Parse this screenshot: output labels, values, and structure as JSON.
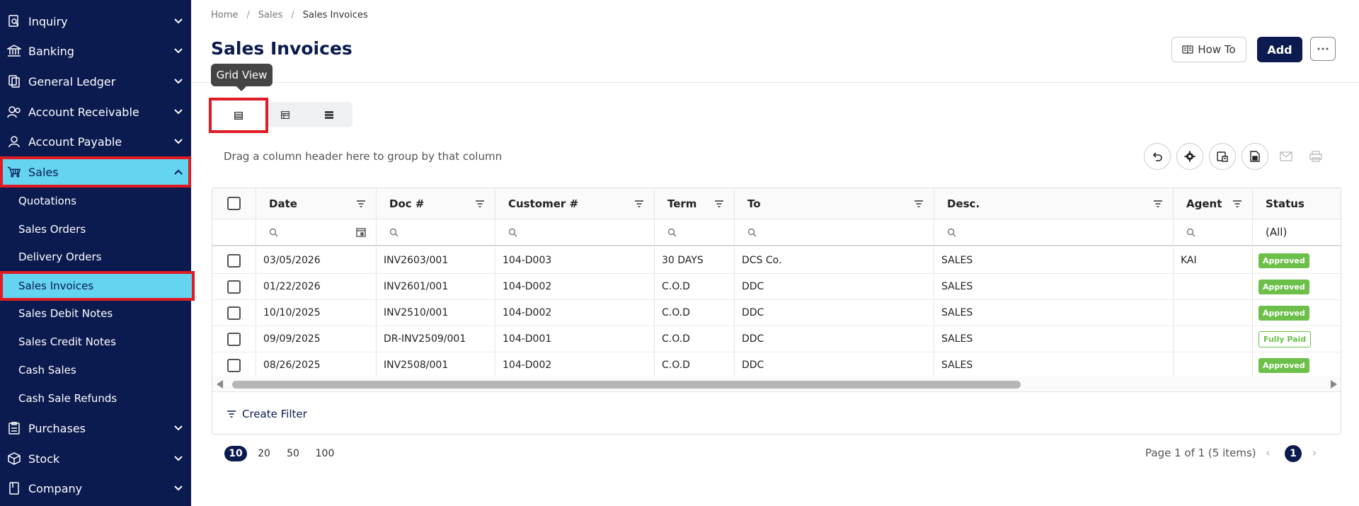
{
  "sidebar": {
    "items": [
      {
        "label": "Inquiry",
        "icon": "inquiry-icon"
      },
      {
        "label": "Banking",
        "icon": "bank-icon"
      },
      {
        "label": "General Ledger",
        "icon": "ledger-icon"
      },
      {
        "label": "Account Receivable",
        "icon": "receivable-icon"
      },
      {
        "label": "Account Payable",
        "icon": "payable-icon"
      },
      {
        "label": "Sales",
        "icon": "cart-icon"
      },
      {
        "label": "Purchases",
        "icon": "purchases-icon"
      },
      {
        "label": "Stock",
        "icon": "box-icon"
      },
      {
        "label": "Company",
        "icon": "book-icon"
      }
    ],
    "sales_sub": [
      "Quotations",
      "Sales Orders",
      "Delivery Orders",
      "Sales Invoices",
      "Sales Debit Notes",
      "Sales Credit Notes",
      "Cash Sales",
      "Cash Sale Refunds"
    ]
  },
  "breadcrumb": {
    "home": "Home",
    "sales": "Sales",
    "current": "Sales Invoices",
    "separator": "/"
  },
  "page": {
    "title": "Sales Invoices"
  },
  "toolbar": {
    "howto_label": "How To",
    "add_label": "Add",
    "tooltip": "Grid View"
  },
  "grid": {
    "group_hint": "Drag a column header here to group by that column",
    "columns": [
      "Date",
      "Doc #",
      "Customer #",
      "Term",
      "To",
      "Desc.",
      "Agent",
      "Status"
    ],
    "status_filter": "(All)",
    "rows": [
      {
        "date": "03/05/2026",
        "doc": "INV2603/001",
        "customer": "104-D003",
        "term": "30 DAYS",
        "to": "DCS Co.",
        "desc": "SALES",
        "agent": "KAI",
        "status": "Approved"
      },
      {
        "date": "01/22/2026",
        "doc": "INV2601/001",
        "customer": "104-D002",
        "term": "C.O.D",
        "to": "DDC",
        "desc": "SALES",
        "agent": "",
        "status": "Approved"
      },
      {
        "date": "10/10/2025",
        "doc": "INV2510/001",
        "customer": "104-D002",
        "term": "C.O.D",
        "to": "DDC",
        "desc": "SALES",
        "agent": "",
        "status": "Approved"
      },
      {
        "date": "09/09/2025",
        "doc": "DR-INV2509/001",
        "customer": "104-D001",
        "term": "C.O.D",
        "to": "DDC",
        "desc": "SALES",
        "agent": "",
        "status": "Fully Paid"
      },
      {
        "date": "08/26/2025",
        "doc": "INV2508/001",
        "customer": "104-D002",
        "term": "C.O.D",
        "to": "DDC",
        "desc": "SALES",
        "agent": "",
        "status": "Approved"
      }
    ],
    "create_filter": "Create Filter"
  },
  "pager": {
    "sizes": [
      "10",
      "20",
      "50",
      "100"
    ],
    "info": "Page 1 of 1 (5 items)",
    "current_page": "1",
    "prev": "‹",
    "next": "›"
  },
  "colors": {
    "sidebar_bg": "#0b1a4f",
    "active_bg": "#64d4f1",
    "highlight": "#e01b24",
    "link": "#26a5d6",
    "approved": "#6cc04a"
  }
}
